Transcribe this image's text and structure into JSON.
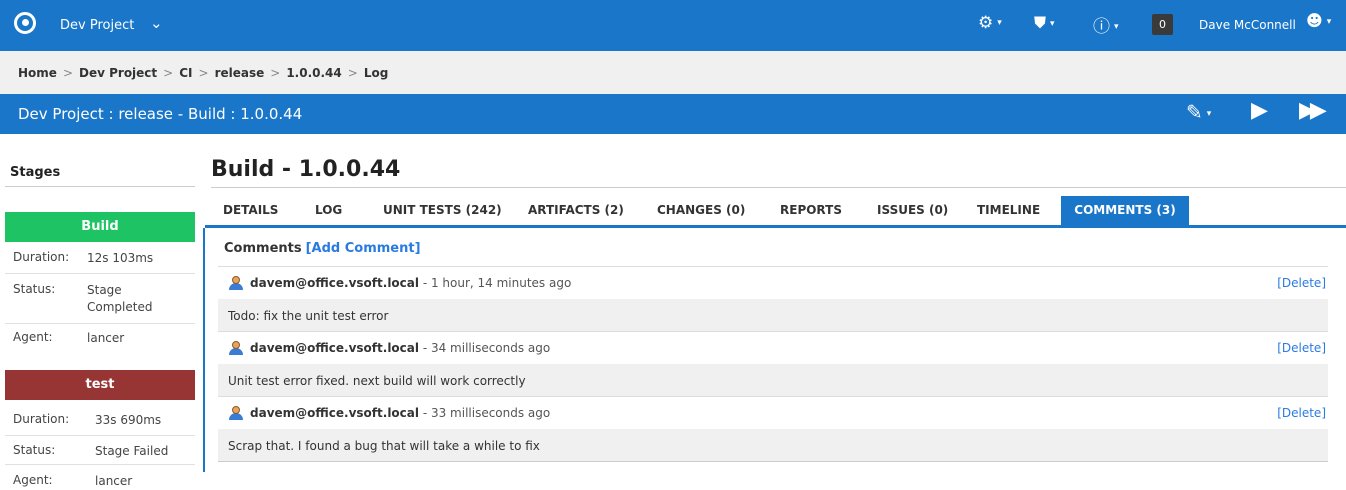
{
  "nav": {
    "project": "Dev Project",
    "notifications": "0",
    "user": "Dave McConnell"
  },
  "breadcrumb": {
    "items": [
      "Home",
      "Dev Project",
      "CI",
      "release",
      "1.0.0.44",
      "Log"
    ],
    "separator": ">"
  },
  "build_bar": {
    "title": "Dev Project : release - Build : 1.0.0.44"
  },
  "stages": {
    "heading": "Stages",
    "list": [
      {
        "name": "Build",
        "color": "#1ec463",
        "duration_label": "Duration:",
        "duration": "12s 103ms",
        "status_label": "Status:",
        "status": "Stage Completed",
        "agent_label": "Agent:",
        "agent": "lancer"
      },
      {
        "name": "test",
        "color": "#973535",
        "duration_label": "Duration:",
        "duration": "33s 690ms",
        "status_label": "Status:",
        "status": "Stage Failed",
        "agent_label": "Agent:",
        "agent": "lancer"
      }
    ]
  },
  "main": {
    "title": "Build - 1.0.0.44",
    "tabs": [
      {
        "label": "DETAILS"
      },
      {
        "label": "LOG"
      },
      {
        "label": "UNIT TESTS (242)"
      },
      {
        "label": "ARTIFACTS (2)"
      },
      {
        "label": "CHANGES (0)"
      },
      {
        "label": "REPORTS"
      },
      {
        "label": "ISSUES (0)"
      },
      {
        "label": "TIMELINE"
      },
      {
        "label": "COMMENTS (3)",
        "active": true
      }
    ],
    "comments_heading": "Comments",
    "add_comment": "[Add Comment]",
    "delete_label": "[Delete]",
    "comments": [
      {
        "author": "davem@office.vsoft.local",
        "ago": " - 1 hour, 14 minutes ago",
        "text": "Todo: fix the unit test error"
      },
      {
        "author": "davem@office.vsoft.local",
        "ago": " - 34 milliseconds ago",
        "text": "Unit test error fixed. next build will work correctly"
      },
      {
        "author": "davem@office.vsoft.local",
        "ago": " - 33 milliseconds ago",
        "text": "Scrap that. I found a bug that will take a while to fix"
      }
    ]
  },
  "colors": {
    "brand_blue": "#1a76c9",
    "success": "#1ec463",
    "failure": "#973535",
    "link": "#2a7be0"
  },
  "icons": [
    "app-logo-icon",
    "chevron-down-icon",
    "gear-icon",
    "shield-icon",
    "help-icon",
    "user-icon",
    "edit-pen-icon",
    "play-icon",
    "fast-forward-icon",
    "avatar-icon"
  ]
}
